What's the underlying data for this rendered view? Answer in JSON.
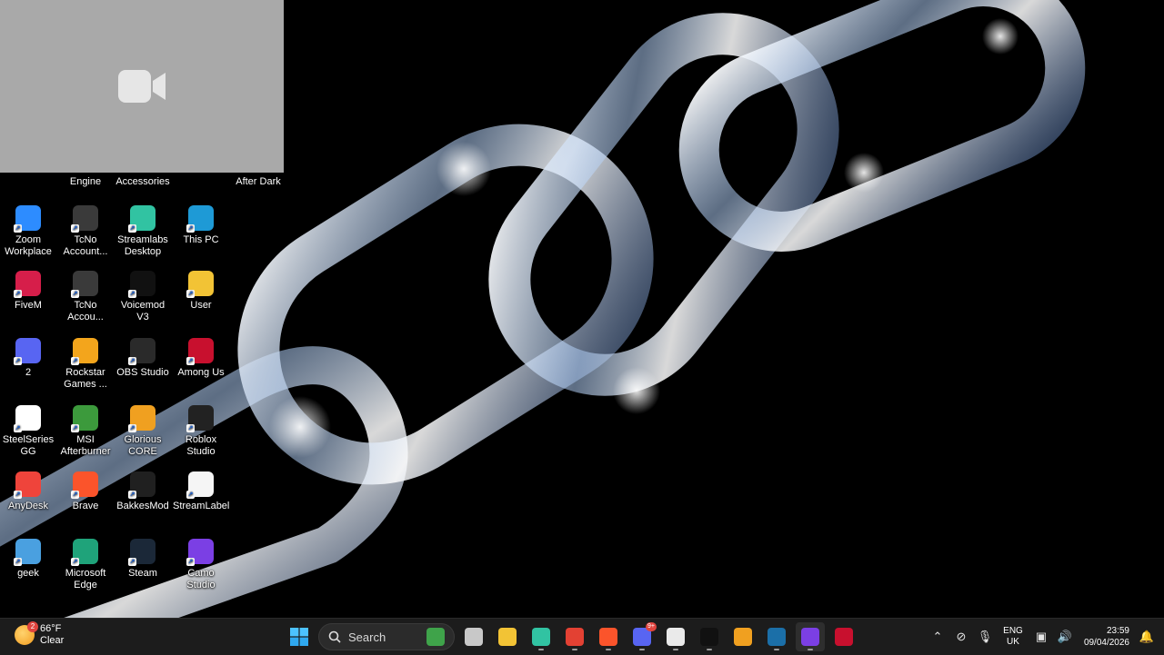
{
  "video_overlay": {
    "icon": "video-camera-icon"
  },
  "desktop": {
    "top_row_labels": [
      "Engine",
      "Accessories",
      "After Dark"
    ],
    "icons": [
      {
        "label": "Zoom Workplace",
        "icon": "zoom-icon",
        "color": "#2d8cff"
      },
      {
        "label": "TcNo Account...",
        "icon": "tcno-icon",
        "color": "#3a3a3a"
      },
      {
        "label": "Streamlabs Desktop",
        "icon": "streamlabs-icon",
        "color": "#31c3a2"
      },
      {
        "label": "This PC",
        "icon": "monitor-icon",
        "color": "#1e9ad6"
      },
      {
        "label": "FiveM",
        "icon": "fivem-icon",
        "color": "#d61e4a"
      },
      {
        "label": "TcNo Accou...",
        "icon": "tcno-icon",
        "color": "#3a3a3a"
      },
      {
        "label": "Voicemod V3",
        "icon": "voicemod-icon",
        "color": "#111111"
      },
      {
        "label": "User",
        "icon": "folder-icon",
        "color": "#f2c335"
      },
      {
        "label": "2",
        "icon": "discord-icon",
        "color": "#5865f2"
      },
      {
        "label": "Rockstar Games ...",
        "icon": "rockstar-icon",
        "color": "#f3a51c"
      },
      {
        "label": "OBS Studio",
        "icon": "obs-icon",
        "color": "#2a2a2a"
      },
      {
        "label": "Among Us",
        "icon": "among-us-icon",
        "color": "#c8102e"
      },
      {
        "label": "SteelSeries GG",
        "icon": "steelseries-icon",
        "color": "#ffffff"
      },
      {
        "label": "MSI Afterburner",
        "icon": "msi-afterburner-icon",
        "color": "#3c9a3c"
      },
      {
        "label": "Glorious CORE",
        "icon": "glorious-icon",
        "color": "#f0a020"
      },
      {
        "label": "Roblox Studio",
        "icon": "roblox-icon",
        "color": "#222222"
      },
      {
        "label": "AnyDesk",
        "icon": "anydesk-icon",
        "color": "#ef443b"
      },
      {
        "label": "Brave",
        "icon": "brave-icon",
        "color": "#fb542b"
      },
      {
        "label": "BakkesMod",
        "icon": "bakkesmod-icon",
        "color": "#202020"
      },
      {
        "label": "StreamLabels",
        "icon": "streamlabels-icon",
        "color": "#f5f5f5"
      },
      {
        "label": "geek",
        "icon": "geek-icon",
        "color": "#4aa0e0"
      },
      {
        "label": "Microsoft Edge",
        "icon": "edge-icon",
        "color": "#1fa37a"
      },
      {
        "label": "Steam",
        "icon": "steam-icon",
        "color": "#1b2838"
      },
      {
        "label": "Camo Studio",
        "icon": "camo-icon",
        "color": "#7b3fe4"
      }
    ]
  },
  "taskbar": {
    "weather": {
      "temp": "66°F",
      "condition": "Clear",
      "badge": "2"
    },
    "search_label": "Search",
    "apps": [
      {
        "name": "task-view",
        "icon": "task-view-icon",
        "color": "#c8c8c8"
      },
      {
        "name": "file-explorer",
        "icon": "folder-icon",
        "color": "#f2c335"
      },
      {
        "name": "streamlabs",
        "icon": "streamlabs-icon",
        "color": "#31c3a2",
        "running": true
      },
      {
        "name": "chrome",
        "icon": "chrome-icon",
        "color": "#e34133",
        "running": true
      },
      {
        "name": "brave",
        "icon": "brave-icon",
        "color": "#fb542b",
        "running": true
      },
      {
        "name": "discord",
        "icon": "discord-icon",
        "color": "#5865f2",
        "running": true,
        "badge": "9+"
      },
      {
        "name": "steelseries",
        "icon": "steelseries-icon",
        "color": "#eaeaea",
        "running": true
      },
      {
        "name": "voicemod",
        "icon": "voicemod-icon",
        "color": "#111111",
        "running": true
      },
      {
        "name": "glorious",
        "icon": "glorious-icon",
        "color": "#f0a020"
      },
      {
        "name": "steam",
        "icon": "steam-icon",
        "color": "#1b6fa8",
        "running": true
      },
      {
        "name": "camo",
        "icon": "camo-icon",
        "color": "#7b3fe4",
        "running": true,
        "active": true
      },
      {
        "name": "among-us",
        "icon": "among-us-icon",
        "color": "#c8102e"
      }
    ],
    "tray": {
      "language": "ENG",
      "region": "UK",
      "time": "23:59",
      "date": "09/04/2026"
    }
  }
}
